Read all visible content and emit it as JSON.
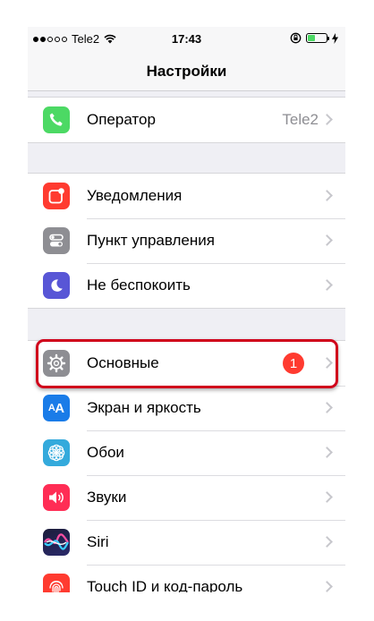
{
  "status_bar": {
    "carrier": "Tele2",
    "time": "17:43"
  },
  "nav": {
    "title": "Настройки"
  },
  "groups": [
    {
      "items": [
        {
          "label": "Оператор",
          "value": "Tele2",
          "icon": "phone-icon",
          "color": "#4cd964"
        }
      ]
    },
    {
      "items": [
        {
          "label": "Уведомления",
          "icon": "notifications-icon",
          "color": "#ff3b30"
        },
        {
          "label": "Пункт управления",
          "icon": "control-center-icon",
          "color": "#8e8e93"
        },
        {
          "label": "Не беспокоить",
          "icon": "moon-icon",
          "color": "#5856d6"
        }
      ]
    },
    {
      "items": [
        {
          "label": "Основные",
          "badge": "1",
          "icon": "gear-icon",
          "color": "#8e8e93"
        },
        {
          "label": "Экран и яркость",
          "icon": "display-icon",
          "color": "#1a7ce8"
        },
        {
          "label": "Обои",
          "icon": "wallpaper-icon",
          "color": "#34aadc"
        },
        {
          "label": "Звуки",
          "icon": "speaker-icon",
          "color": "#ff2d55"
        },
        {
          "label": "Siri",
          "icon": "siri-icon",
          "color": "#1c1c3a"
        },
        {
          "label": "Touch ID и код-пароль",
          "icon": "fingerprint-icon",
          "color": "#ff3b30"
        }
      ]
    }
  ],
  "highlight_color": "#d0021b"
}
